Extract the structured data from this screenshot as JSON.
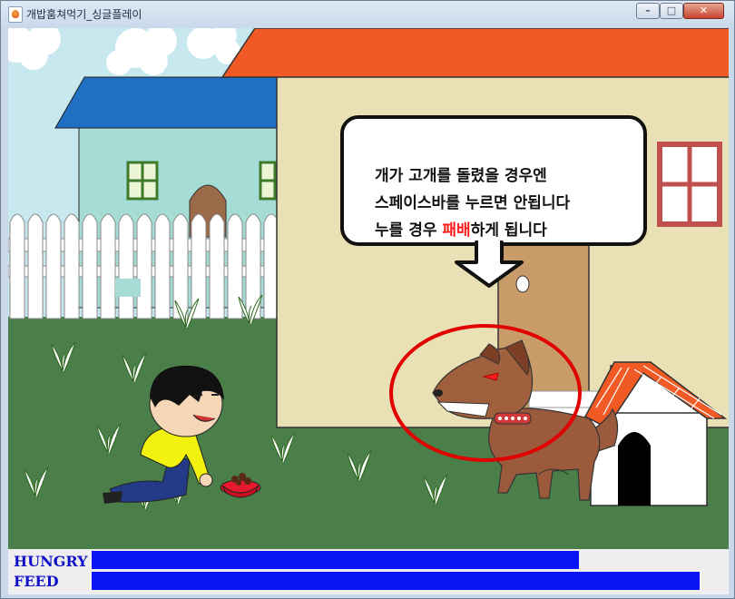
{
  "window": {
    "title": "개밥훔쳐먹기_싱글플레이",
    "controls": {
      "minimize": "–",
      "maximize": "□",
      "close": "✕"
    }
  },
  "scene": {
    "speech_bubble": {
      "line1": "개가 고개를 돌렸을 경우엔",
      "line2": "스페이스바를 누르면 안됩니다",
      "line3_before": "누를 경우 ",
      "line3_highlight": "패배",
      "line3_after": "하게 됩니다"
    },
    "sprites": [
      "boy-character",
      "dog-character",
      "dog-food-bowl",
      "doghouse",
      "house",
      "fence"
    ],
    "colors": {
      "roof": "#f15a24",
      "grass": "#4b7f4a",
      "house_wall": "#e9e0b5",
      "warning_circle": "#e00000",
      "highlight_text": "#ff1a1a"
    }
  },
  "status": {
    "hungry_label": "HUNGRY",
    "feed_label": "FEED",
    "hungry_level": 0.79,
    "feed_level": 0.985,
    "bar_color": "#0a14f5"
  }
}
